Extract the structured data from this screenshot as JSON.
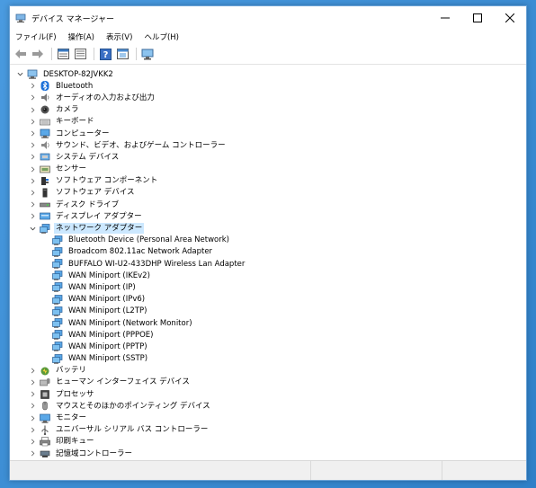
{
  "window": {
    "title": "デバイス マネージャー"
  },
  "menu": [
    "ファイル(F)",
    "操作(A)",
    "表示(V)",
    "ヘルプ(H)"
  ],
  "toolbar_icons": [
    "back-arrow-icon",
    "forward-arrow-icon",
    "properties-icon",
    "device-list-icon",
    "help-icon",
    "update-driver-icon",
    "monitor-scan-icon"
  ],
  "tree": {
    "root": "DESKTOP-82JVKK2",
    "categories": [
      {
        "label": "Bluetooth",
        "icon": "bluetooth-icon",
        "expanded": false
      },
      {
        "label": "オーディオの入力および出力",
        "icon": "speaker-icon",
        "expanded": false
      },
      {
        "label": "カメラ",
        "icon": "camera-icon",
        "expanded": false
      },
      {
        "label": "キーボード",
        "icon": "keyboard-icon",
        "expanded": false
      },
      {
        "label": "コンピューター",
        "icon": "computer-icon",
        "expanded": false
      },
      {
        "label": "サウンド、ビデオ、およびゲーム コントローラー",
        "icon": "sound-icon",
        "expanded": false
      },
      {
        "label": "システム デバイス",
        "icon": "system-device-icon",
        "expanded": false
      },
      {
        "label": "センサー",
        "icon": "sensor-icon",
        "expanded": false
      },
      {
        "label": "ソフトウェア コンポーネント",
        "icon": "software-component-icon",
        "expanded": false
      },
      {
        "label": "ソフトウェア デバイス",
        "icon": "software-device-icon",
        "expanded": false
      },
      {
        "label": "ディスク ドライブ",
        "icon": "disk-drive-icon",
        "expanded": false
      },
      {
        "label": "ディスプレイ アダプター",
        "icon": "display-adapter-icon",
        "expanded": false
      },
      {
        "label": "ネットワーク アダプター",
        "icon": "network-adapter-icon",
        "expanded": true,
        "selected": true,
        "children": [
          "Bluetooth Device (Personal Area Network)",
          "Broadcom 802.11ac Network Adapter",
          "BUFFALO WI-U2-433DHP Wireless Lan Adapter",
          "WAN Miniport (IKEv2)",
          "WAN Miniport (IP)",
          "WAN Miniport (IPv6)",
          "WAN Miniport (L2TP)",
          "WAN Miniport (Network Monitor)",
          "WAN Miniport (PPPOE)",
          "WAN Miniport (PPTP)",
          "WAN Miniport (SSTP)"
        ]
      },
      {
        "label": "バッテリ",
        "icon": "battery-icon",
        "expanded": false
      },
      {
        "label": "ヒューマン インターフェイス デバイス",
        "icon": "hid-icon",
        "expanded": false
      },
      {
        "label": "プロセッサ",
        "icon": "processor-icon",
        "expanded": false
      },
      {
        "label": "マウスとそのほかのポインティング デバイス",
        "icon": "mouse-icon",
        "expanded": false
      },
      {
        "label": "モニター",
        "icon": "monitor-icon",
        "expanded": false
      },
      {
        "label": "ユニバーサル シリアル バス コントローラー",
        "icon": "usb-icon",
        "expanded": false
      },
      {
        "label": "印刷キュー",
        "icon": "printer-icon",
        "expanded": false
      },
      {
        "label": "記憶域コントローラー",
        "icon": "storage-controller-icon",
        "expanded": false
      }
    ]
  },
  "colors": {
    "selection": "#cce8ff",
    "desktop": "#3d8fd6",
    "accent": "#2f74c4"
  }
}
